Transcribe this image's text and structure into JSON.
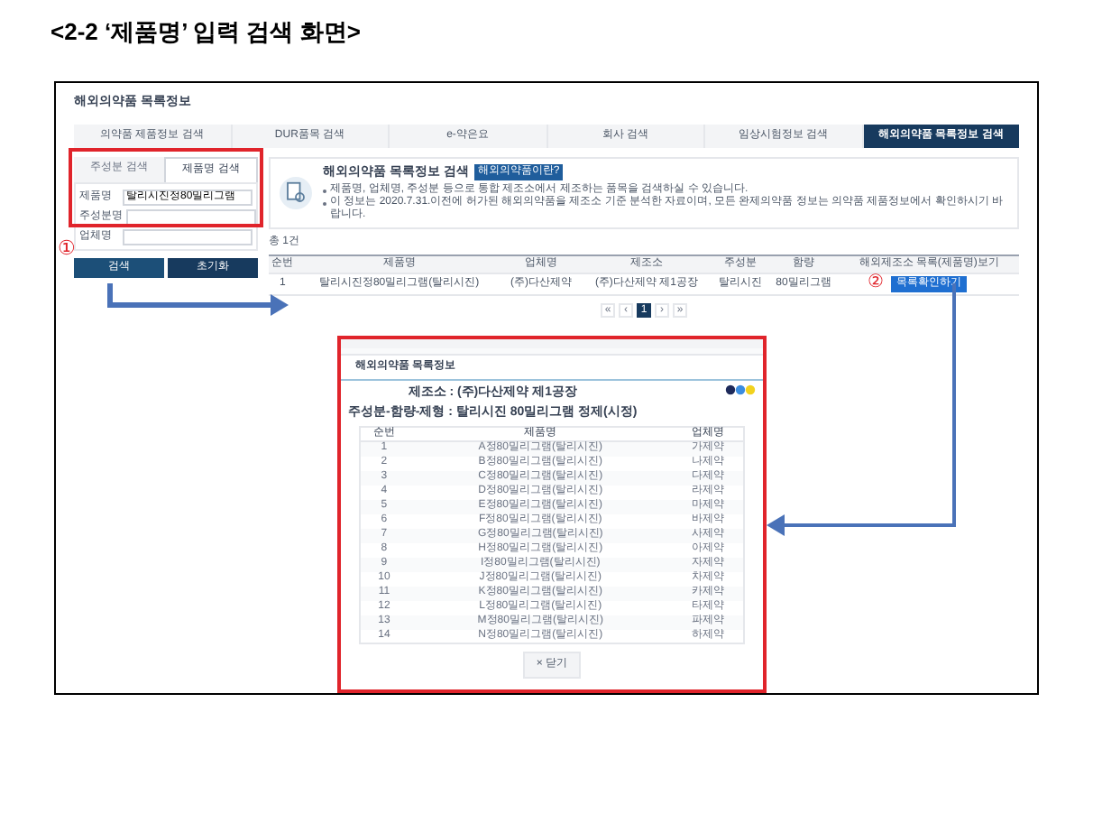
{
  "caption": "<2-2 ‘제품명’ 입력 검색 화면>",
  "page": {
    "title": "해외의약품 목록정보",
    "tabs": [
      {
        "label": "의약품 제품정보 검색",
        "selected": false
      },
      {
        "label": "DUR품목 검색",
        "selected": false
      },
      {
        "label": "e-약은요",
        "selected": false
      },
      {
        "label": "회사 검색",
        "selected": false
      },
      {
        "label": "임상시험정보 검색",
        "selected": false
      },
      {
        "label": "해외의약품 목록정보 검색",
        "selected": true
      }
    ],
    "search_tabs": [
      {
        "label": "주성분 검색",
        "selected": false
      },
      {
        "label": "제품명 검색",
        "selected": true
      }
    ],
    "fields": [
      {
        "label": "제품명",
        "value": "탈리시진정80밀리그램"
      },
      {
        "label": "주성분명"
      },
      {
        "label": "업체명"
      }
    ],
    "buttons": [
      "검색",
      "초기화"
    ],
    "info": {
      "heading": "해외의약품 목록정보 검색",
      "badge": "해외의약품이란?",
      "bullets": [
        "제품명, 업체명, 주성분 등으로 통합 제조소에서 제조하는 품목을 검색하실 수 있습니다.",
        "이 정보는 2020.7.31.이전에 허가된 해외의약품을 제조소 기준 분석한 자료이며, 모든 완제의약품 정보는 의약품 제품정보에서 확인하시기 바랍니다."
      ]
    },
    "count": "총 1건",
    "table": {
      "columns": [
        "순번",
        "제품명",
        "업체명",
        "제조소",
        "주성분",
        "함량",
        "해외제조소 목록(제품명)보기"
      ],
      "rows": [
        {
          "cells": [
            "1",
            "탈리시진정80밀리그램(탈리시진)",
            "(주)다산제약",
            "(주)다산제약 제1공장",
            "탈리시진",
            "80밀리그램"
          ],
          "action": "목록확인하기"
        }
      ]
    },
    "pagination": [
      {
        "label": "«",
        "selected": false
      },
      {
        "label": "‹",
        "selected": false
      },
      {
        "label": "1",
        "selected": true
      },
      {
        "label": "›",
        "selected": false
      },
      {
        "label": "»",
        "selected": false
      }
    ]
  },
  "popup": {
    "title": "해외의약품 목록정보",
    "site": "제조소 : (주)다산제약 제1공장",
    "substance": "주성분-함량-제형 : 탈리시진 80밀리그램 정제(시정)",
    "columns": [
      "순번",
      "제품명",
      "업체명"
    ],
    "rows": [
      [
        "1",
        "A정80밀리그램(탈리시진)",
        "가제약"
      ],
      [
        "2",
        "B정80밀리그램(탈리시진)",
        "나제약"
      ],
      [
        "3",
        "C정80밀리그램(탈리시진)",
        "다제약"
      ],
      [
        "4",
        "D정80밀리그램(탈리시진)",
        "라제약"
      ],
      [
        "5",
        "E정80밀리그램(탈리시진)",
        "마제약"
      ],
      [
        "6",
        "F정80밀리그램(탈리시진)",
        "바제약"
      ],
      [
        "7",
        "G정80밀리그램(탈리시진)",
        "사제약"
      ],
      [
        "8",
        "H정80밀리그램(탈리시진)",
        "아제약"
      ],
      [
        "9",
        "I정80밀리그램(탈리시진)",
        "자제약"
      ],
      [
        "10",
        "J정80밀리그램(탈리시진)",
        "차제약"
      ],
      [
        "11",
        "K정80밀리그램(탈리시진)",
        "카제약"
      ],
      [
        "12",
        "L정80밀리그램(탈리시진)",
        "타제약"
      ],
      [
        "13",
        "M정80밀리그램(탈리시진)",
        "파제약"
      ],
      [
        "14",
        "N정80밀리그램(탈리시진)",
        "하제약"
      ]
    ],
    "close": "× 닫기"
  },
  "markers": [
    "①",
    "②"
  ]
}
